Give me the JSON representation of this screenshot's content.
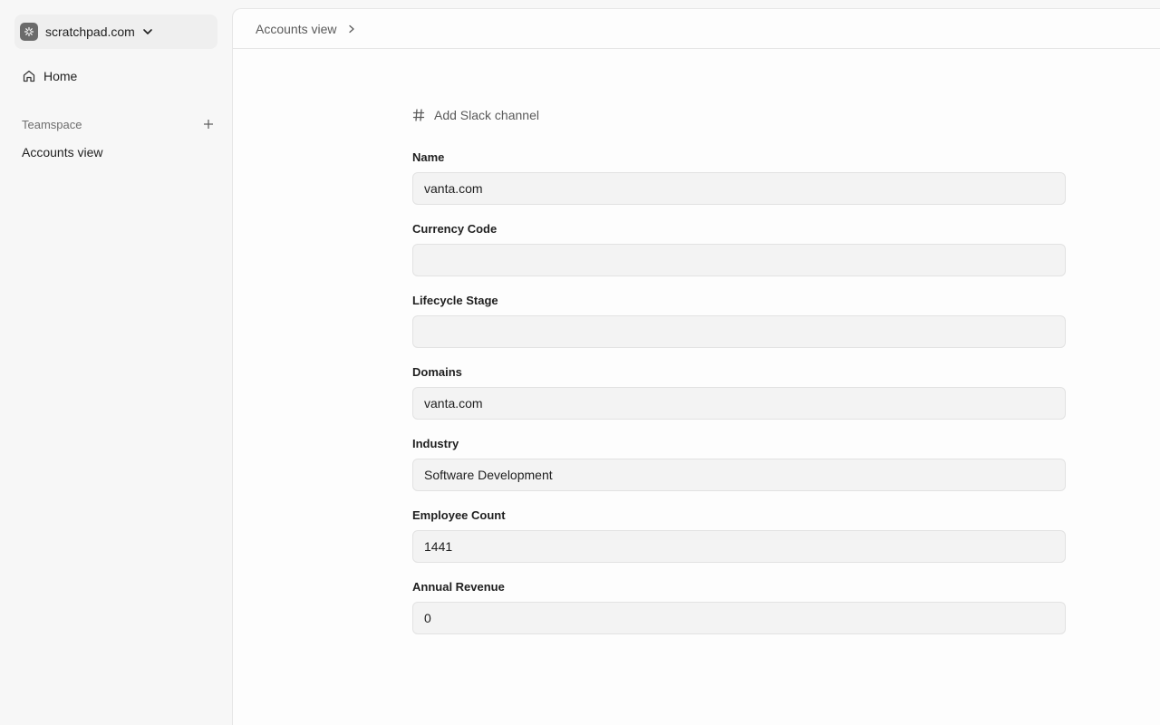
{
  "sidebar": {
    "workspace": {
      "name": "scratchpad.com",
      "icon": "workspace-logo-icon"
    },
    "home": {
      "label": "Home",
      "icon": "home-icon"
    },
    "teamspace": {
      "label": "Teamspace",
      "add_icon": "plus-icon"
    },
    "items": [
      {
        "label": "Accounts view"
      }
    ]
  },
  "header": {
    "breadcrumb": "Accounts view"
  },
  "form": {
    "slack": {
      "label": "Add Slack channel",
      "icon": "hash-icon"
    },
    "fields": [
      {
        "label": "Name",
        "value": "vanta.com"
      },
      {
        "label": "Currency Code",
        "value": ""
      },
      {
        "label": "Lifecycle Stage",
        "value": ""
      },
      {
        "label": "Domains",
        "value": "vanta.com"
      },
      {
        "label": "Industry",
        "value": "Software Development"
      },
      {
        "label": "Employee Count",
        "value": "1441"
      },
      {
        "label": "Annual Revenue",
        "value": "0"
      }
    ]
  },
  "colors": {
    "background": "#f7f7f7",
    "panel": "#fdfdfd",
    "input_bg": "#f3f3f3",
    "border": "#e6e6e6"
  }
}
